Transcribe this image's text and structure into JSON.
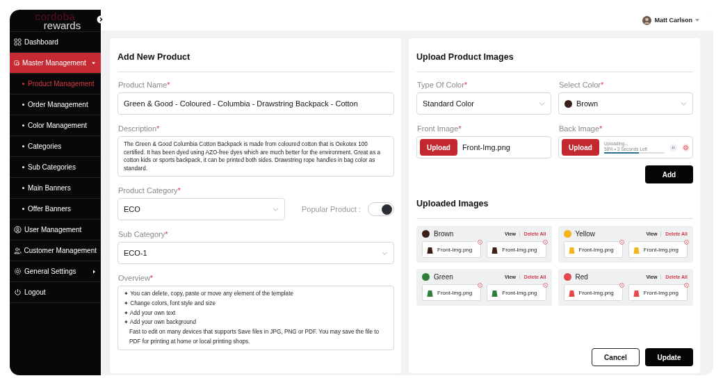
{
  "sidebar": {
    "logo_top": "cordoba",
    "logo_bottom": "rewards",
    "items": [
      {
        "label": "Dashboard",
        "selected": false
      },
      {
        "label": "Master Management",
        "selected": true,
        "expanded": true,
        "children": [
          {
            "label": "Product Management",
            "selected": true
          },
          {
            "label": "Order Management",
            "selected": false
          },
          {
            "label": "Color Management",
            "selected": false
          },
          {
            "label": "Categories",
            "selected": false
          },
          {
            "label": "Sub Categories",
            "selected": false
          },
          {
            "label": "Main Banners",
            "selected": false
          },
          {
            "label": "Offer Banners",
            "selected": false
          }
        ]
      },
      {
        "label": "User Management",
        "selected": false
      },
      {
        "label": "Customer Management",
        "selected": false
      },
      {
        "label": "General Settings",
        "selected": false,
        "expanded": false
      },
      {
        "label": "Logout",
        "selected": false
      }
    ]
  },
  "user": {
    "name": "Matt Carlson"
  },
  "required_mark": "*",
  "product_form": {
    "title": "Add New Product",
    "product_name": {
      "label": "Product Name",
      "value": "Green & Good - Coloured - Columbia - Drawstring Backpack - Cotton"
    },
    "description": {
      "label": "Description",
      "value": "The Green & Good Columbia Cotton Backpack is made from coloured cotton that is Oekotex 100 certified. It has been dyed using AZO-free dyes which are much better for the environment. Great as a cotton kids or sports backpack, it can be printed both sides. Drawstring rope handles in bag color as standard."
    },
    "product_category": {
      "label": "Product Category",
      "value": "ECO"
    },
    "popular_product": {
      "label": "Popular Product :",
      "on": true
    },
    "sub_category": {
      "label": "Sub Category",
      "value": "ECO-1"
    },
    "overview": {
      "label": "Overview",
      "bullets": [
        "You can delete, copy, paste or move any element of the template",
        "Change colors, font style and size",
        "Add your own text",
        "Add your own background"
      ],
      "bullet_mark": "✦",
      "note": "Fast to edit on many devices that supports Save files in JPG, PNG or PDF. You may save the file to PDF for printing at home or local printing shops."
    }
  },
  "image_form": {
    "title": "Upload Product Images",
    "type_of_color": {
      "label": "Type Of Color",
      "value": "Standard Color"
    },
    "select_color": {
      "label": "Select Color",
      "value": "Brown",
      "color": "#3b1f17"
    },
    "front_image": {
      "label": "Front Image",
      "button": "Upload",
      "file": "Front-Img.png"
    },
    "back_image": {
      "label": "Back Image",
      "button": "Upload",
      "status": "Uploading...",
      "progress_text": "58% • 3 Seconds Left",
      "level": 0.58
    },
    "add_button": "Add",
    "uploaded_title": "Uploaded Images",
    "groups": [
      {
        "name": "Brown",
        "color": "#3b1f17",
        "view": "View",
        "delete_all": "Delete All",
        "files": [
          "Front-Img.png",
          "Front-Img.png"
        ]
      },
      {
        "name": "Yellow",
        "color": "#f2b418",
        "view": "View",
        "delete_all": "Delete All",
        "files": [
          "Front-Img.png",
          "Front-Img.png"
        ]
      },
      {
        "name": "Green",
        "color": "#2e7d3a",
        "view": "View",
        "delete_all": "Delete All",
        "files": [
          "Front-Img.png",
          "Front-Img.png"
        ]
      },
      {
        "name": "Red",
        "color": "#e5484d",
        "view": "View",
        "delete_all": "Delete All",
        "files": [
          "Front-Img.png",
          "Front-Img.png"
        ]
      }
    ],
    "cancel_button": "Cancel",
    "update_button": "Update"
  }
}
